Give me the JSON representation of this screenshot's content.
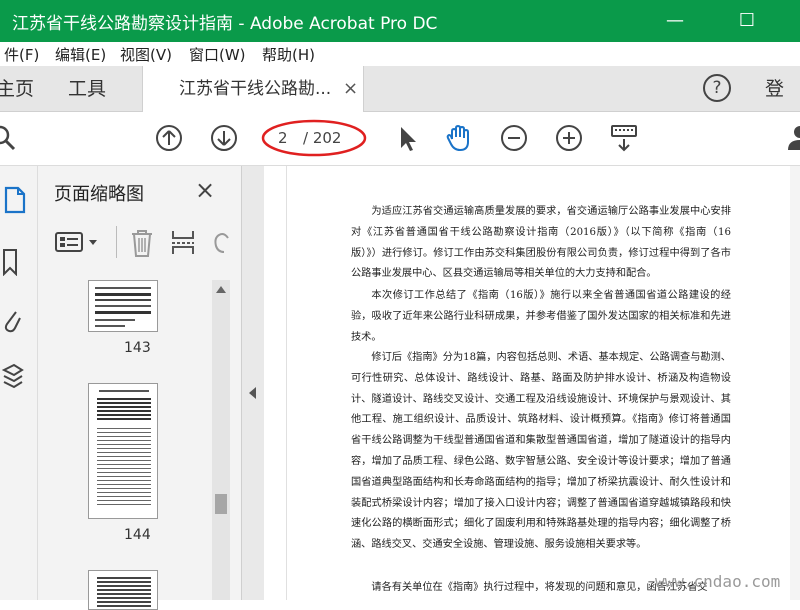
{
  "window": {
    "title": "江苏省干线公路勘察设计指南 - Adobe Acrobat Pro DC",
    "minimize": "—",
    "maximize": "☐"
  },
  "menu": [
    {
      "label": "件(F)"
    },
    {
      "label": "编辑(E)"
    },
    {
      "label": "视图(V)"
    },
    {
      "label": "窗口(W)"
    },
    {
      "label": "帮助(H)"
    }
  ],
  "tabs": {
    "home": "主页",
    "tools": "工具",
    "doc": "江苏省干线公路勘...",
    "close": "×",
    "help": "?",
    "login": "登录"
  },
  "toolbar": {
    "page_current": "2",
    "page_total": "/ 202"
  },
  "panel": {
    "title": "页面缩略图",
    "close": "×"
  },
  "thumbnails": [
    {
      "label": "143"
    },
    {
      "label": "144"
    }
  ],
  "document": {
    "paragraphs": [
      "为适应江苏省交通运输高质量发展的要求，省交通运输厅公路事业发展中心安排对《江苏省普通国省干线公路勘察设计指南（2016版）》（以下简称《指南（16版）》）进行修订。修订工作由苏交科集团股份有限公司负责，修订过程中得到了各市公路事业发展中心、区县交通运输局等相关单位的大力支持和配合。",
      "本次修订工作总结了《指南（16版）》施行以来全省普通国省道公路建设的经验，吸收了近年来公路行业科研成果，并参考借鉴了国外发达国家的相关标准和先进技术。",
      "修订后《指南》分为18篇，内容包括总则、术语、基本规定、公路调查与勘测、可行性研究、总体设计、路线设计、路基、路面及防护排水设计、桥涵及构造物设计、隧道设计、路线交叉设计、交通工程及沿线设施设计、环境保护与景观设计、其他工程、施工组织设计、品质设计、筑路材料、设计概预算。《指南》修订将普通国省干线公路调整为干线型普通国省道和集散型普通国省道，增加了隧道设计的指导内容，增加了品质工程、绿色公路、数字智慧公路、安全设计等设计要求；增加了普通国省道典型路面结构和长寿命路面结构的指导；增加了桥梁抗震设计、耐久性设计和装配式桥梁设计内容；增加了接入口设计内容；调整了普通国省道穿越城镇路段和快速化公路的横断面形式；细化了固废利用和特殊路基处理的指导内容；细化调整了桥涵、路线交叉、交通安全设施、管理设施、服务设施相关要求等。",
      "请各有关单位在《指南》执行过程中，将发现的问题和意见，函告江苏省交"
    ]
  },
  "watermark": "www.cndao.com",
  "colors": {
    "titlebar": "#0a9a4a",
    "accent": "#1a73c8",
    "annotation": "#e02020"
  }
}
